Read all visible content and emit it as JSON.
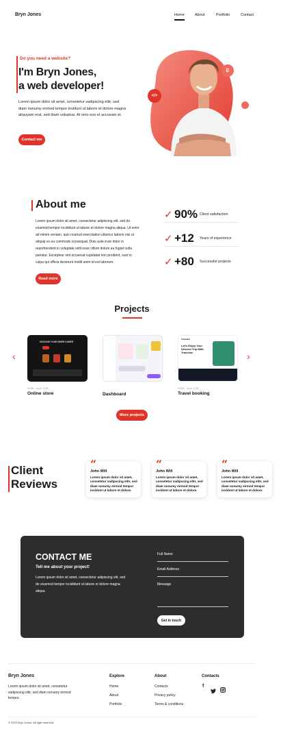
{
  "nav": {
    "brand": "Bryn Jones",
    "links": [
      "Home",
      "About",
      "Portfolio",
      "Contact"
    ]
  },
  "hero": {
    "kicker": "Do you need a website?",
    "title_line1": "I'm Bryn Jones,",
    "title_line2": "a web developer!",
    "text": "Lorem ipsum dolor sit amet, consetetur sadipscing elitr, sed diam nonumy eirmod tempor invidunt ut labore et dolore magna aliquyam erat, sed diam voluptua. At vero eos et accusam et.",
    "cta": "Contact me",
    "badge_code": "</>",
    "badge_e": "E"
  },
  "about": {
    "title": "About me",
    "text": "Lorem ipsum dolor sit amet, consectetur adipiscing elit, sed do eiusmod tempor incididunt ut labore et dolore magna aliqua. Ut enim ad minim veniam, quis nostrud exercitation ullamco laboris nisi ut aliquip ex ea commodo consequat. Duis aute irure dolor in reprehenderit in voluptate velit esse cillum dolore eu fugiat nulla pariatur. Excepteur sint occaecat cupidatat non proident, sunt in culpa qui officia deserunt mollit anim id est laborum.",
    "cta": "Read more",
    "stats": [
      {
        "check": "✓",
        "value": "90%",
        "label": "Client satisfaction"
      },
      {
        "check": "✓",
        "value": "+12",
        "label": "Years of experience"
      },
      {
        "check": "✓",
        "value": "+80",
        "label": "Successful projects"
      }
    ]
  },
  "projects": {
    "title": "Projects",
    "prev": "‹",
    "next": "›",
    "items": [
      {
        "tag": "HTML, Java, CSS",
        "name": "Online store"
      },
      {
        "tag": "",
        "name": "Dashboard"
      },
      {
        "tag": "HTML, Java, CSS",
        "name": "Travel booking"
      }
    ],
    "cta": "More projects",
    "thumb_text": {
      "store_heading": "UNLEASH YOUR INNER GAMER",
      "travel_heading": "Let's Enjoy Your Desired Trip With Traveline",
      "travel_logo": "Traveline"
    }
  },
  "reviews": {
    "title_line1": "Client",
    "title_line2": "Reviews",
    "quote_mark": "“",
    "items": [
      {
        "name": "John Will",
        "text": "Lorem ipsum dolor sit amet, consetetur sadipscing elitr, sed diam nonumy eirmod tempor invidunt ut labore et dolore."
      },
      {
        "name": "John Will",
        "text": "Lorem ipsum dolor sit amet, consetetur sadipscing elitr, sed diam nonumy eirmod tempor invidunt ut labore et dolore."
      },
      {
        "name": "John Will",
        "text": "Lorem ipsum dolor sit amet, consetetur sadipscing elitr, sed diam nonumy eirmod tempor invidunt ut labore et dolore."
      }
    ]
  },
  "contact": {
    "title": "CONTACT ME",
    "subtitle": "Tell me about your project!",
    "text": "Lorem ipsum dolor sit amet, consectetur adipiscing elit, sed do eiusmod tempor incididunt ut labore et dolore magna aliqua.",
    "fields": [
      "Full Name",
      "Email Address",
      "Message"
    ],
    "submit": "Get in touch"
  },
  "footer": {
    "brand": "Bryn Jones",
    "text": "Lorem ipsum dolor sit amet, consetetur sadipscing elitr, sed diam nonumy eirmod tempor.",
    "explore_title": "Explore",
    "explore": [
      "Home",
      "About",
      "Portfolio"
    ],
    "about_title": "About",
    "about": [
      "Contacts",
      "Privacy policy",
      "Terms & conditions"
    ],
    "contacts_title": "Contacts",
    "social": {
      "facebook": "f",
      "twitter": "t",
      "instagram": "o"
    },
    "copyright": "© 2023 Bryn Jones. All right reserved."
  },
  "colors": {
    "accent": "#e0342a",
    "dark": "#2d2d2d"
  }
}
